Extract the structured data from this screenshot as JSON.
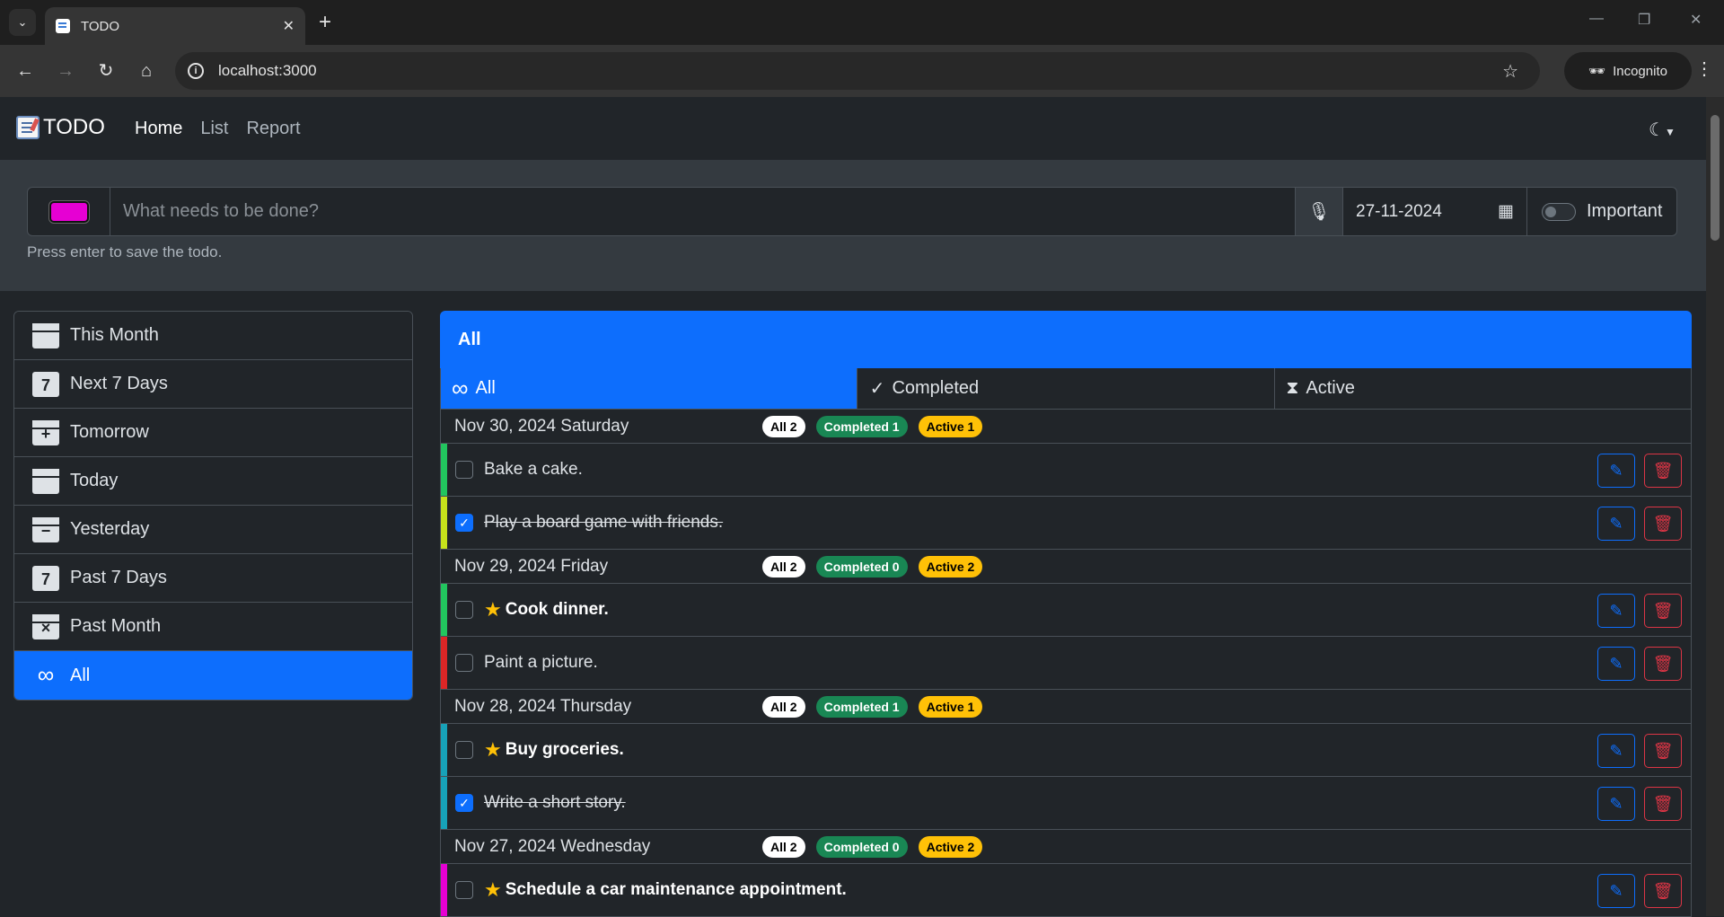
{
  "browser": {
    "tab_title": "TODO",
    "url": "localhost:3000",
    "incognito_label": "Incognito"
  },
  "app": {
    "brand": "TODO",
    "nav": [
      "Home",
      "List",
      "Report"
    ]
  },
  "input": {
    "placeholder": "What needs to be done?",
    "date_value": "27-11-2024",
    "important_label": "Important",
    "hint": "Press enter to save the todo.",
    "color": "#e600d3"
  },
  "sidebar": {
    "items": [
      {
        "label": "This Month",
        "icon": "calendar-month-icon",
        "glyph": ""
      },
      {
        "label": "Next 7 Days",
        "icon": "next-seven-icon",
        "glyph": "7"
      },
      {
        "label": "Tomorrow",
        "icon": "calendar-plus-icon",
        "glyph": "+"
      },
      {
        "label": "Today",
        "icon": "calendar-today-icon",
        "glyph": ""
      },
      {
        "label": "Yesterday",
        "icon": "calendar-minus-icon",
        "glyph": "−"
      },
      {
        "label": "Past 7 Days",
        "icon": "past-seven-icon",
        "glyph": "7"
      },
      {
        "label": "Past Month",
        "icon": "calendar-x-icon",
        "glyph": "×"
      },
      {
        "label": "All",
        "icon": "infinity-icon",
        "glyph": "∞"
      }
    ]
  },
  "main": {
    "header": "All",
    "tabs": [
      "All",
      "Completed",
      "Active"
    ]
  },
  "groups": [
    {
      "date": "Nov 30, 2024 Saturday",
      "all": "All 2",
      "completed": "Completed 1",
      "active": "Active 1",
      "todos": [
        {
          "text": "Bake a cake.",
          "done": false,
          "important": false,
          "color": "#22c55e"
        },
        {
          "text": "Play a board game with friends.",
          "done": true,
          "important": false,
          "color": "#c6e21b"
        }
      ]
    },
    {
      "date": "Nov 29, 2024 Friday",
      "all": "All 2",
      "completed": "Completed 0",
      "active": "Active 2",
      "todos": [
        {
          "text": "Cook dinner.",
          "done": false,
          "important": true,
          "color": "#22c55e"
        },
        {
          "text": "Paint a picture.",
          "done": false,
          "important": false,
          "color": "#dc2626"
        }
      ]
    },
    {
      "date": "Nov 28, 2024 Thursday",
      "all": "All 2",
      "completed": "Completed 1",
      "active": "Active 1",
      "todos": [
        {
          "text": "Buy groceries.",
          "done": false,
          "important": true,
          "color": "#17a2b8"
        },
        {
          "text": "Write a short story.",
          "done": true,
          "important": false,
          "color": "#17a2b8"
        }
      ]
    },
    {
      "date": "Nov 27, 2024 Wednesday",
      "all": "All 2",
      "completed": "Completed 0",
      "active": "Active 2",
      "todos": [
        {
          "text": "Schedule a car maintenance appointment.",
          "done": false,
          "important": true,
          "color": "#e600d3"
        }
      ]
    }
  ]
}
